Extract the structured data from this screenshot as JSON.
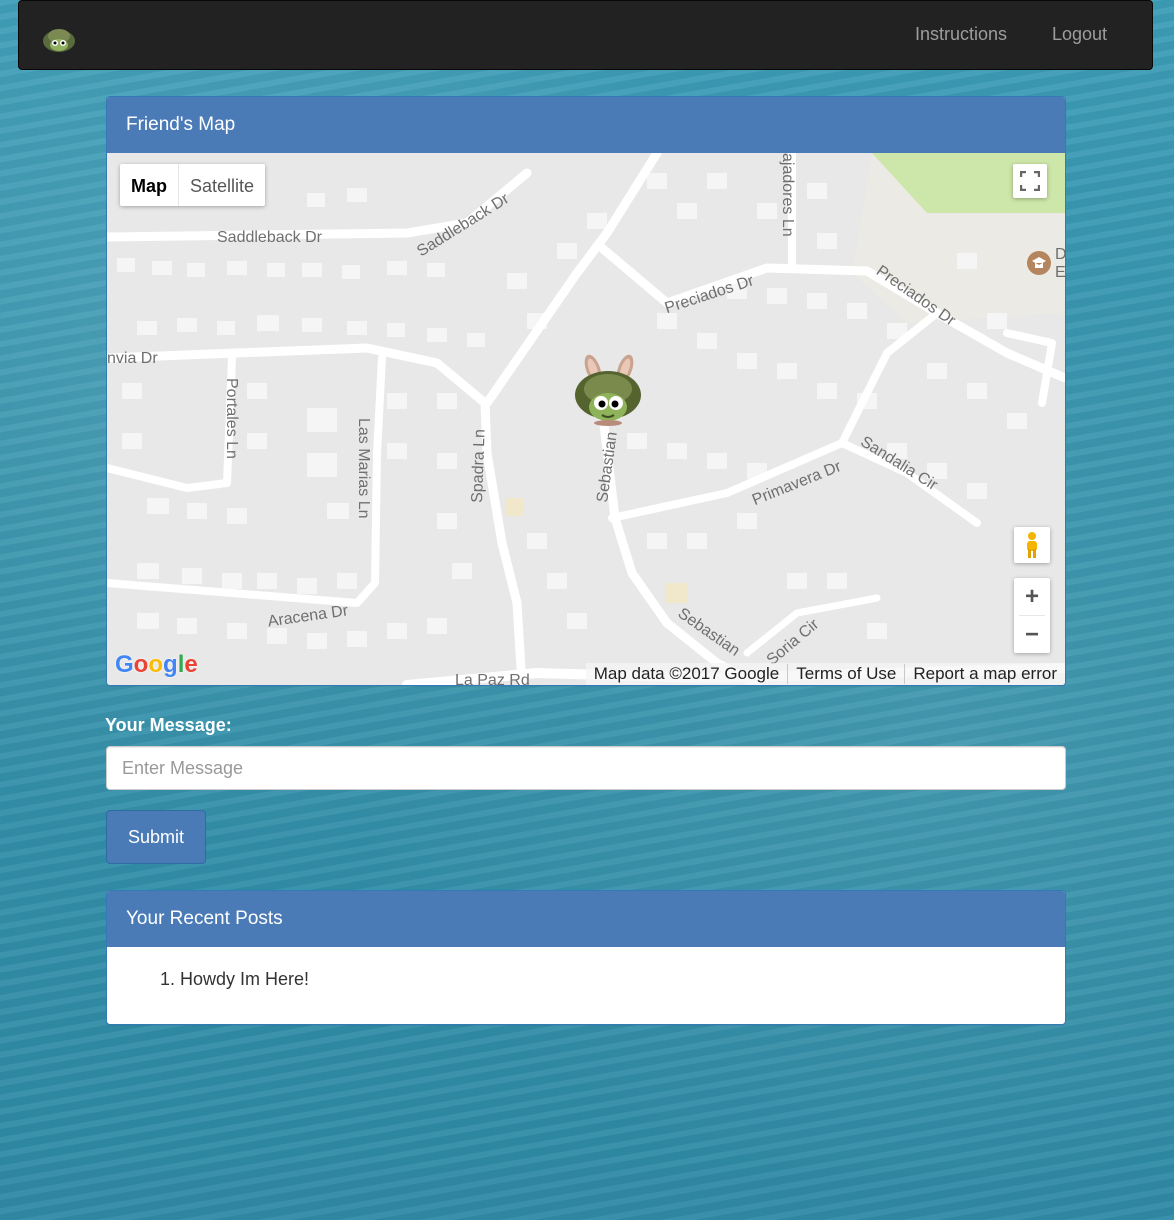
{
  "navbar": {
    "brand_icon": "turtle-logo-icon",
    "links": [
      {
        "label": "Instructions"
      },
      {
        "label": "Logout"
      }
    ]
  },
  "map_panel": {
    "title": "Friend's Map",
    "map_type_buttons": [
      "Map",
      "Satellite"
    ],
    "active_map_type": "Map",
    "zoom_in": "+",
    "zoom_out": "−",
    "logo_letters": [
      "G",
      "o",
      "o",
      "g",
      "l",
      "e"
    ],
    "attribution": [
      "Map data ©2017 Google",
      "Terms of Use",
      "Report a map error"
    ],
    "street_labels": [
      "Saddleback Dr",
      "Saddleback Dr",
      "Preciados Dr",
      "Preciados Dr",
      "nvia Dr",
      "Portales Ln",
      "Las Marias Ln",
      "Spadra Ln",
      "Sebastian",
      "Primavera Dr",
      "Sandalia Cir",
      "Aracena Dr",
      "Sebastian",
      "Soria Cir",
      "La Paz Rd",
      "ajadores Ln",
      "D",
      "E"
    ],
    "marker_icon": "turtle-marker-icon"
  },
  "message_form": {
    "label": "Your Message:",
    "placeholder": "Enter Message",
    "value": "",
    "submit_label": "Submit"
  },
  "posts_panel": {
    "title": "Your Recent Posts",
    "items": [
      "Howdy Im Here!"
    ]
  },
  "colors": {
    "navbar_bg": "#222222",
    "panel_heading": "#4a7bb7",
    "water_bg": "#3592ab",
    "park_green": "#cde6a9"
  }
}
